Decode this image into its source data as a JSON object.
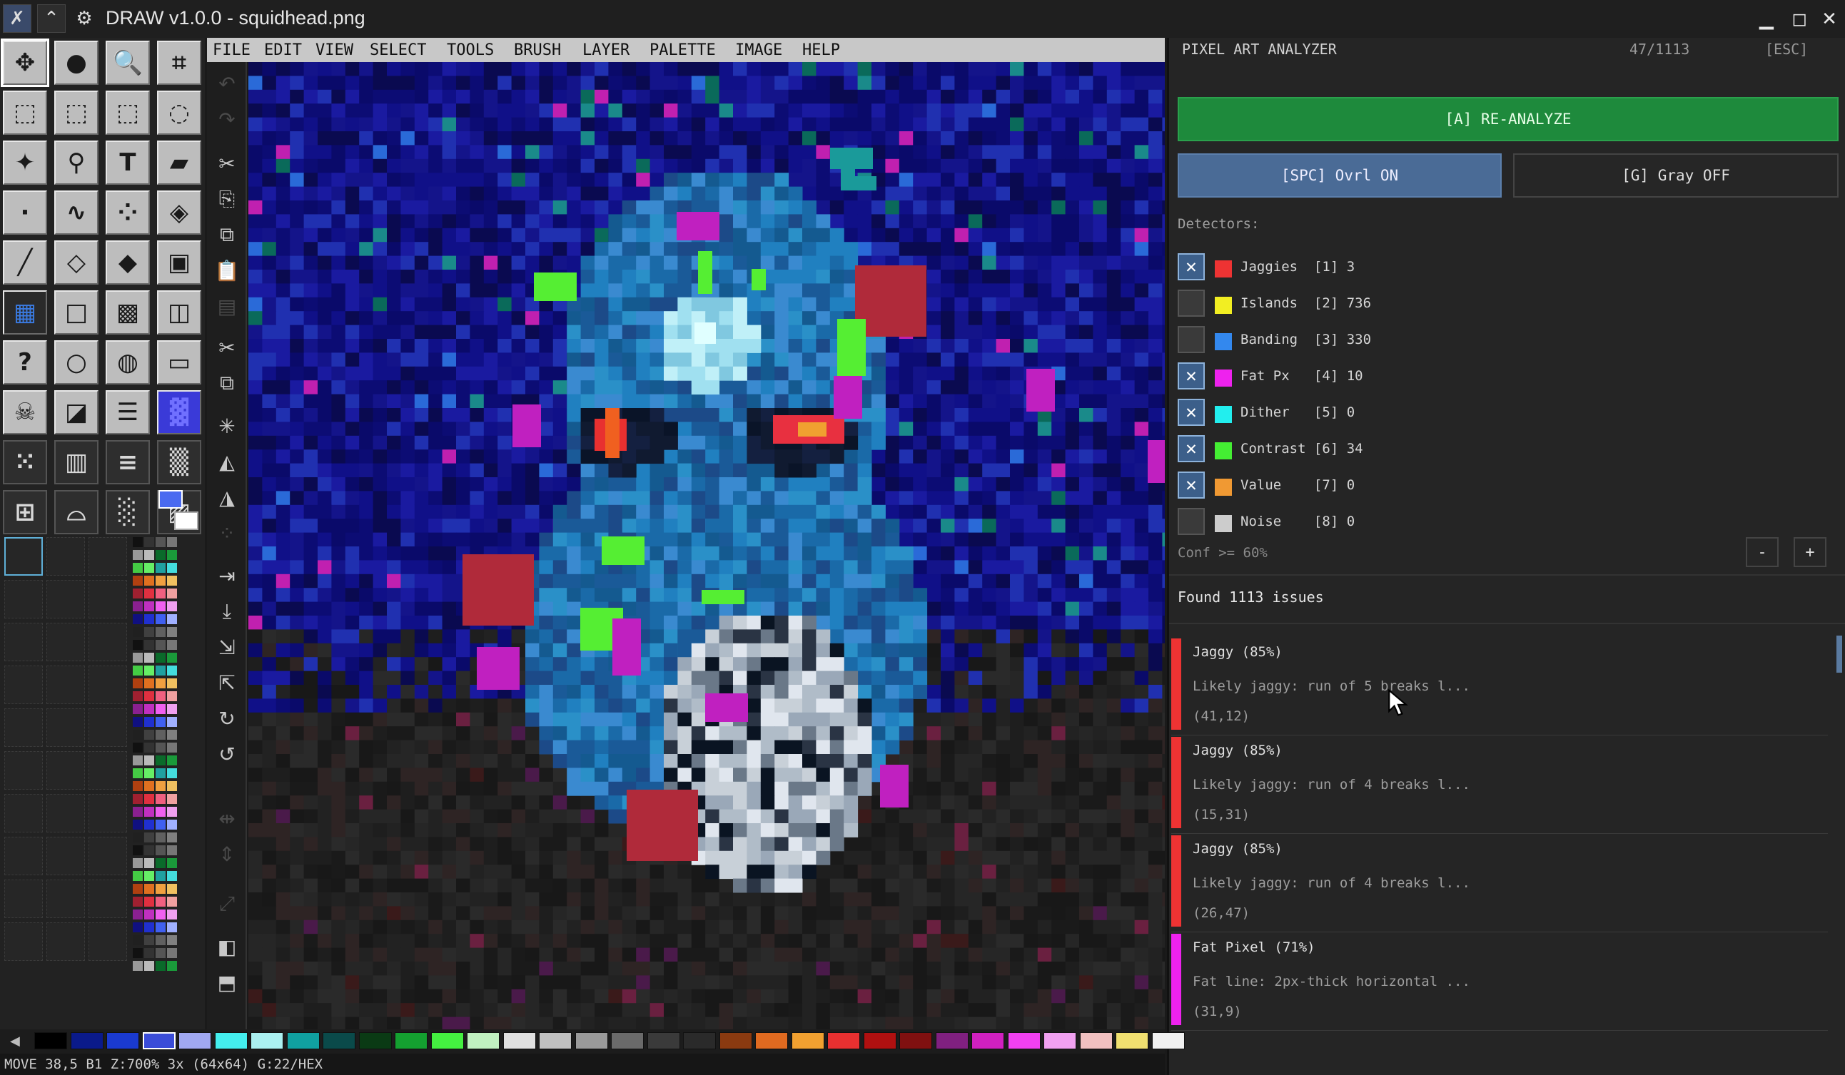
{
  "titlebar": {
    "title": "DRAW v1.0.0 - squidhead.png",
    "app_icon": "brush-x-icon",
    "buttons": [
      "chevron-up-icon",
      "gear-icon"
    ],
    "window_controls": [
      "minimize-icon",
      "maximize-icon",
      "close-icon"
    ]
  },
  "menu": [
    "FILE",
    "EDIT",
    "VIEW",
    "SELECT",
    "TOOLS",
    "BRUSH",
    "LAYER",
    "PALETTE",
    "IMAGE",
    "HELP"
  ],
  "panel": {
    "title": "PIXEL ART ANALYZER",
    "counter": "47/1113",
    "esc": "[ESC]",
    "reanalyze": "[A] RE-ANALYZE",
    "overlay": "[SPC] Ovrl ON",
    "gray": "[G] Gray OFF",
    "detectors_label": "Detectors:",
    "detectors": [
      {
        "label": "Jaggies  [1] 3",
        "checked": true,
        "color": "#ee3333"
      },
      {
        "label": "Islands  [2] 736",
        "checked": false,
        "color": "#f2ee22"
      },
      {
        "label": "Banding  [3] 330",
        "checked": false,
        "color": "#3388ee"
      },
      {
        "label": "Fat Px   [4] 10",
        "checked": true,
        "color": "#ee22ee"
      },
      {
        "label": "Dither   [5] 0",
        "checked": true,
        "color": "#22eeee"
      },
      {
        "label": "Contrast [6] 34",
        "checked": true,
        "color": "#44ee33"
      },
      {
        "label": "Value    [7] 0",
        "checked": true,
        "color": "#f09933"
      },
      {
        "label": "Noise    [8] 0",
        "checked": false,
        "color": "#cccccc"
      }
    ],
    "conf": "Conf >= 60%",
    "minus": "-",
    "plus": "+",
    "found": "Found 1113 issues",
    "issues": [
      {
        "title": "Jaggy (85%)",
        "desc": "Likely jaggy: run of 5 breaks l...",
        "pos": "(41,12)",
        "color": "#ee3333"
      },
      {
        "title": "Jaggy (85%)",
        "desc": "Likely jaggy: run of 4 breaks l...",
        "pos": "(15,31)",
        "color": "#ee3333"
      },
      {
        "title": "Jaggy (85%)",
        "desc": "Likely jaggy: run of 4 breaks l...",
        "pos": "(26,47)",
        "color": "#ee3333"
      },
      {
        "title": "Fat Pixel (71%)",
        "desc": "Fat line: 2px-thick horizontal ...",
        "pos": "(31,9)",
        "color": "#ee22ee"
      }
    ]
  },
  "status": "MOVE  38,5 B1 Z:700% 3x (64x64) G:22/HEX",
  "palette": [
    "#000000",
    "#0a1a8a",
    "#1a3ad0",
    "#3a4cd8",
    "#a0a8f0",
    "#44eeee",
    "#aaf0f0",
    "#10a0a0",
    "#0a4a4a",
    "#0a3a14",
    "#14a030",
    "#44f040",
    "#c0f0c0",
    "#e0e0e0",
    "#c0c0c0",
    "#9a9a9a",
    "#6a6a6a",
    "#3a3a3a",
    "#2a2a2a",
    "#8a3a10",
    "#e06a20",
    "#f0a030",
    "#e83030",
    "#b01010",
    "#801010",
    "#802080",
    "#d020c0",
    "#f040f0",
    "#f0a0f0",
    "#f0c0c0",
    "#f0e070",
    "#f0f0f0"
  ]
}
